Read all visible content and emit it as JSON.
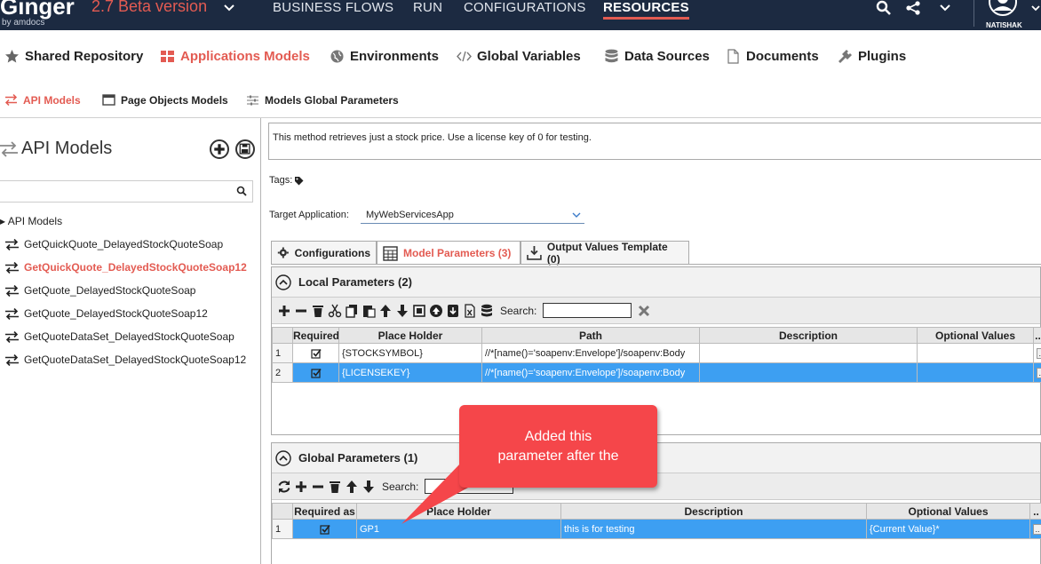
{
  "app": {
    "logo": "Ginger",
    "logo_sub": "by amdocs",
    "version": "2.7 Beta version",
    "user": "NATISHAK"
  },
  "top_nav": [
    "BUSINESS FLOWS",
    "RUN",
    "CONFIGURATIONS",
    "RESOURCES"
  ],
  "resource_tabs": [
    "Shared Repository",
    "Applications Models",
    "Environments",
    "Global  Variables",
    "Data Sources",
    "Documents",
    "Plugins"
  ],
  "sub_tabs": [
    "API Models",
    "Page Objects Models",
    "Models Global Parameters"
  ],
  "left": {
    "title": "API Models",
    "tree_root": "API Models",
    "items": [
      "GetQuickQuote_DelayedStockQuoteSoap",
      "GetQuickQuote_DelayedStockQuoteSoap12",
      "GetQuote_DelayedStockQuoteSoap",
      "GetQuote_DelayedStockQuoteSoap12",
      "GetQuoteDataSet_DelayedStockQuoteSoap",
      "GetQuoteDataSet_DelayedStockQuoteSoap12"
    ]
  },
  "right": {
    "description": "This method retrieves just a stock price.  Use a license key of 0 for testing.",
    "tags_label": "Tags:",
    "target_label": "Target Application:",
    "target_value": "MyWebServicesApp",
    "tabs": [
      "Configurations",
      "Model Parameters (3)",
      "Output Values Template (0)"
    ]
  },
  "local": {
    "title": "Local Parameters (2)",
    "search_label": "Search:",
    "headers": [
      "Required",
      "Place Holder",
      "Path",
      "Description",
      "Optional Values",
      ".."
    ],
    "rows": [
      {
        "num": "1",
        "placeholder": "{STOCKSYMBOL}",
        "path": "//*[name()='soapenv:Envelope']/soapenv:Body",
        "description": "",
        "optional": ""
      },
      {
        "num": "2",
        "placeholder": "{LICENSEKEY}",
        "path": "//*[name()='soapenv:Envelope']/soapenv:Body",
        "description": "",
        "optional": ""
      }
    ]
  },
  "global": {
    "title": "Global Parameters (1)",
    "search_label": "Search:",
    "headers": [
      "Required as",
      "Place Holder",
      "Description",
      "Optional Values",
      ".."
    ],
    "rows": [
      {
        "num": "1",
        "placeholder": "GP1",
        "description": "this is for testing",
        "optional": "{Current Value}*"
      }
    ]
  },
  "callout": {
    "line1": "Added this",
    "line2": "parameter after the"
  },
  "colors": {
    "topbar": "#1c2a41",
    "accent": "#e35b52",
    "selection": "#3d9ff2",
    "callout": "#f5464a"
  }
}
